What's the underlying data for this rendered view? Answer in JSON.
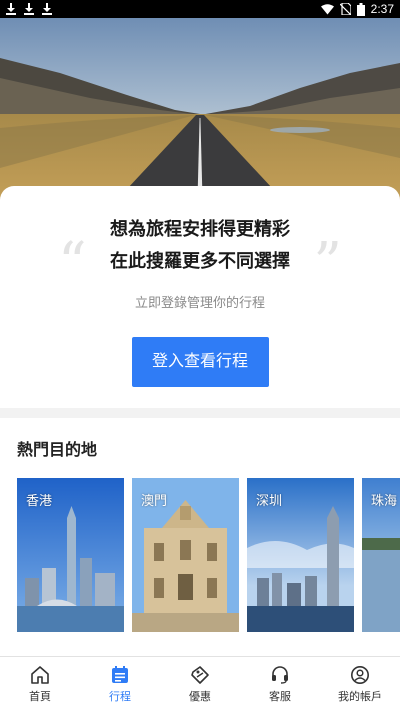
{
  "status_bar": {
    "time": "2:37"
  },
  "card": {
    "headline_line1": "想為旅程安排得更精彩",
    "headline_line2": "在此搜羅更多不同選擇",
    "subtitle": "立即登錄管理你的行程",
    "login_button": "登入查看行程",
    "quote_open": "“",
    "quote_close": "”"
  },
  "popular": {
    "title": "熱門目的地",
    "destinations": [
      {
        "name": "香港"
      },
      {
        "name": "澳門"
      },
      {
        "name": "深圳"
      },
      {
        "name": "珠海"
      }
    ]
  },
  "tabbar": {
    "items": [
      {
        "label": "首頁",
        "icon": "home-icon"
      },
      {
        "label": "行程",
        "icon": "itinerary-icon",
        "active": true
      },
      {
        "label": "優惠",
        "icon": "coupon-icon"
      },
      {
        "label": "客服",
        "icon": "headset-icon"
      },
      {
        "label": "我的帳戶",
        "icon": "account-icon"
      }
    ]
  },
  "colors": {
    "accent": "#2f7cf6"
  }
}
